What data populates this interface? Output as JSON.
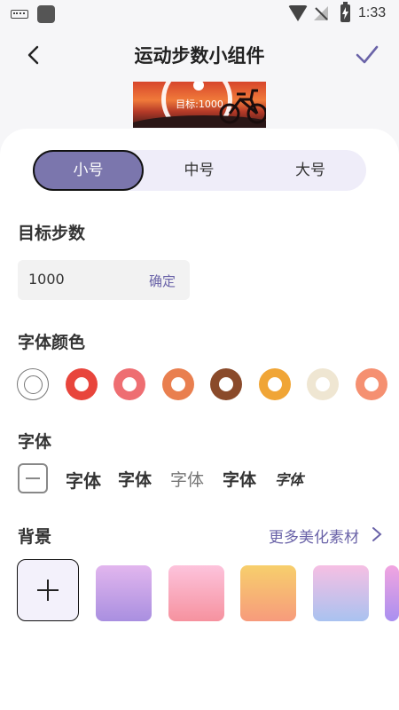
{
  "status_bar": {
    "time": "1:33"
  },
  "header": {
    "title": "运动步数小组件"
  },
  "preview": {
    "goal_text": "目标:1000"
  },
  "size_tabs": [
    {
      "label": "小号",
      "selected": true
    },
    {
      "label": "中号",
      "selected": false
    },
    {
      "label": "大号",
      "selected": false
    }
  ],
  "target_steps": {
    "label": "目标步数",
    "value": "1000",
    "confirm_label": "确定"
  },
  "font_color": {
    "label": "字体颜色",
    "options": [
      {
        "name": "none",
        "color": "#ffffff"
      },
      {
        "name": "red",
        "color": "#e8453c"
      },
      {
        "name": "pink",
        "color": "#ee6e72"
      },
      {
        "name": "orange",
        "color": "#e97f4f"
      },
      {
        "name": "brown",
        "color": "#8a4a2a"
      },
      {
        "name": "amber",
        "color": "#f0a536"
      },
      {
        "name": "cream",
        "color": "#efe6d2"
      },
      {
        "name": "salmon",
        "color": "#f59071"
      }
    ]
  },
  "font": {
    "label": "字体",
    "options": [
      "字体",
      "字体",
      "字体",
      "字体",
      "字体"
    ]
  },
  "background": {
    "label": "背景",
    "more_label": "更多美化素材",
    "tiles": [
      {
        "name": "lavender",
        "from": "#e2b6ee",
        "to": "#a98fe0"
      },
      {
        "name": "pink",
        "from": "#fdc3dc",
        "to": "#f6929f"
      },
      {
        "name": "peach",
        "from": "#f7cf6c",
        "to": "#f79b7c"
      },
      {
        "name": "rainbow",
        "from": "#f6bfe3",
        "to": "#a9c2f0"
      },
      {
        "name": "violet",
        "from": "#f2a5e0",
        "to": "#a98ff0"
      }
    ]
  },
  "accent_color": "#7b76ad"
}
